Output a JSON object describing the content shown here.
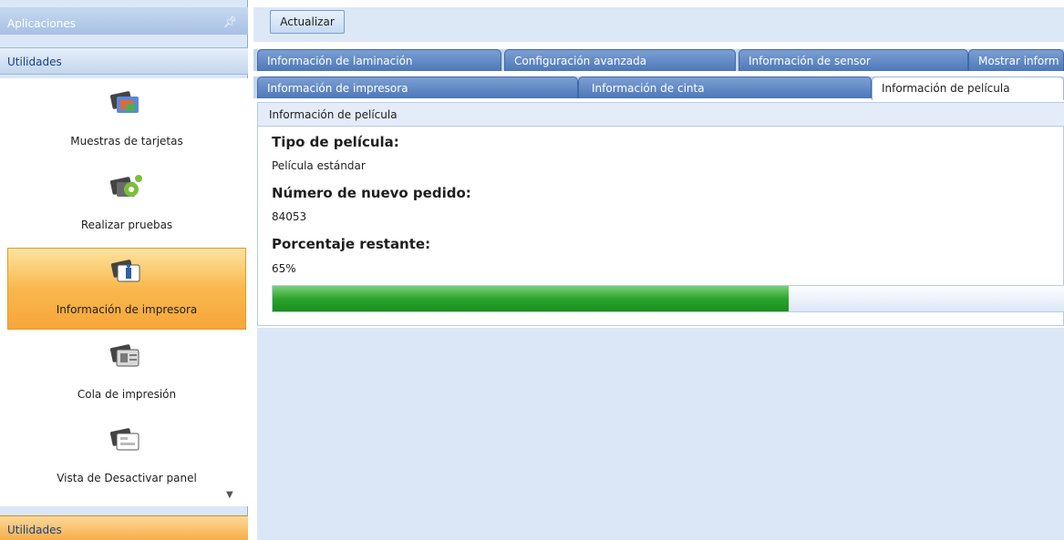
{
  "sidebar": {
    "header": "Aplicaciones",
    "section_top": "Utilidades",
    "section_bottom": "Utilidades",
    "items": [
      {
        "label": "Muestras de tarjetas",
        "icon": "card-samples-icon"
      },
      {
        "label": "Realizar pruebas",
        "icon": "tests-gear-icon"
      },
      {
        "label": "Información de impresora",
        "icon": "printer-info-icon",
        "selected": true
      },
      {
        "label": "Cola de impresión",
        "icon": "print-queue-icon"
      },
      {
        "label": "Vista de Desactivar panel",
        "icon": "disable-panel-icon"
      }
    ]
  },
  "toolbar": {
    "refresh_label": "Actualizar"
  },
  "tabs_row1": [
    {
      "label": "Información de laminación"
    },
    {
      "label": "Configuración avanzada"
    },
    {
      "label": "Información de sensor"
    },
    {
      "label": "Mostrar inform"
    }
  ],
  "tabs_row2": [
    {
      "label": "Información de impresora"
    },
    {
      "label": "Información de cinta"
    },
    {
      "label": "Información de película",
      "active": true
    }
  ],
  "content": {
    "title": "Información de película",
    "film_type_label": "Tipo de película:",
    "film_type_value": "Película estándar",
    "reorder_label": "Número de nuevo pedido:",
    "reorder_value": "84053",
    "remaining_label": "Porcentaje restante:",
    "remaining_value": "65%",
    "remaining_fraction": 0.65
  },
  "colors": {
    "accent_selected": "#f7a63a",
    "progress": "#2ca42c",
    "tab": "#4d78b8"
  }
}
